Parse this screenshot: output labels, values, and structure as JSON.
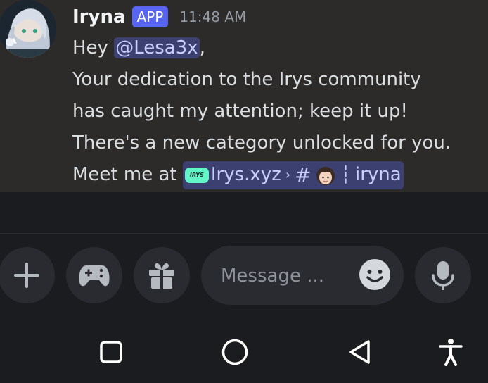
{
  "message": {
    "author": "Iryna",
    "badge": "APP",
    "timestamp": "11:48 AM",
    "greeting_prefix": "Hey ",
    "mention": "@Lesa3x",
    "greeting_suffix": ",",
    "line2": "Your dedication to the Irys community",
    "line3": "has caught my attention; keep it up!",
    "line4": "There's a new category unlocked for you.",
    "line5_prefix": "Meet me at ",
    "server_logo_text": "IRYS",
    "server_name": "Irys.xyz",
    "channel_name": "iryna"
  },
  "composer": {
    "placeholder": "Message ..."
  },
  "icons": {
    "add": "plus-icon",
    "games": "gamepad-icon",
    "gift": "gift-icon",
    "emoji": "emoji-icon",
    "voice": "microphone-icon",
    "nav_recents": "square-icon",
    "nav_home": "circle-icon",
    "nav_back": "triangle-back-icon",
    "nav_accessibility": "accessibility-icon"
  },
  "colors": {
    "background": "#1b1c20",
    "message_bg": "#2c2b2a",
    "badge": "#5865f2",
    "mention_bg": "#3c4070",
    "mention_text": "#c9cdfb",
    "irys_logo": "#62f5c7"
  }
}
